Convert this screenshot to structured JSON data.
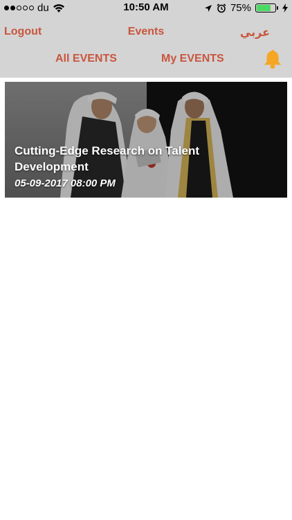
{
  "status_bar": {
    "carrier": "du",
    "time": "10:50 AM",
    "battery_percent": "75%",
    "battery_level": 0.75,
    "signal_bars_filled": 2,
    "signal_bars_total": 5,
    "icons": [
      "wifi-icon",
      "location-arrow-icon",
      "alarm-icon",
      "battery-icon",
      "charging-bolt-icon"
    ]
  },
  "nav": {
    "logout_label": "Logout",
    "title": "Events",
    "language_label": "عربي"
  },
  "tabs": {
    "all_label": "All EVENTS",
    "my_label": "My EVENTS",
    "bell_icon": "bell-icon"
  },
  "events": [
    {
      "title": "Cutting-Edge Research on Talent Development",
      "datetime": "05-09-2017 08:00 PM"
    }
  ],
  "colors": {
    "accent": "#c8553d",
    "nav_background": "#d4d4d4",
    "bell": "#f5a623",
    "battery_fill": "#4cd964"
  }
}
